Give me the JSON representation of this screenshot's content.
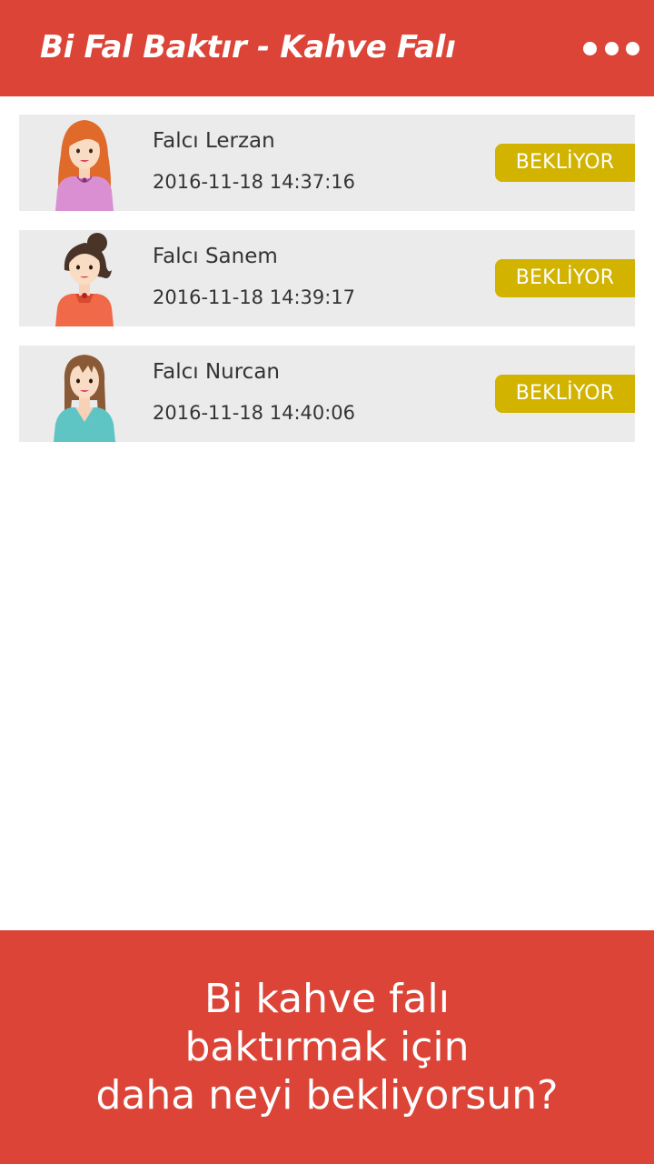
{
  "header": {
    "title": "Bi Fal Baktır - Kahve Falı",
    "menu_icon": "more-horizontal-icon",
    "background_color": "#db4437"
  },
  "fortune_tellers": [
    {
      "name": "Falcı Lerzan",
      "timestamp": "2016-11-18 14:37:16",
      "status": "BEKLİYOR",
      "avatar": "red-haired-woman-pink-dress"
    },
    {
      "name": "Falcı Sanem",
      "timestamp": "2016-11-18 14:39:17",
      "status": "BEKLİYOR",
      "avatar": "brunette-bun-woman-orange-dress"
    },
    {
      "name": "Falcı Nurcan",
      "timestamp": "2016-11-18 14:40:06",
      "status": "BEKLİYOR",
      "avatar": "brown-haired-woman-teal-dress"
    }
  ],
  "status_color": "#d1b300",
  "cta": {
    "lines": [
      "Bi kahve falı",
      "baktırmak için",
      "daha neyi bekliyorsun?"
    ]
  }
}
